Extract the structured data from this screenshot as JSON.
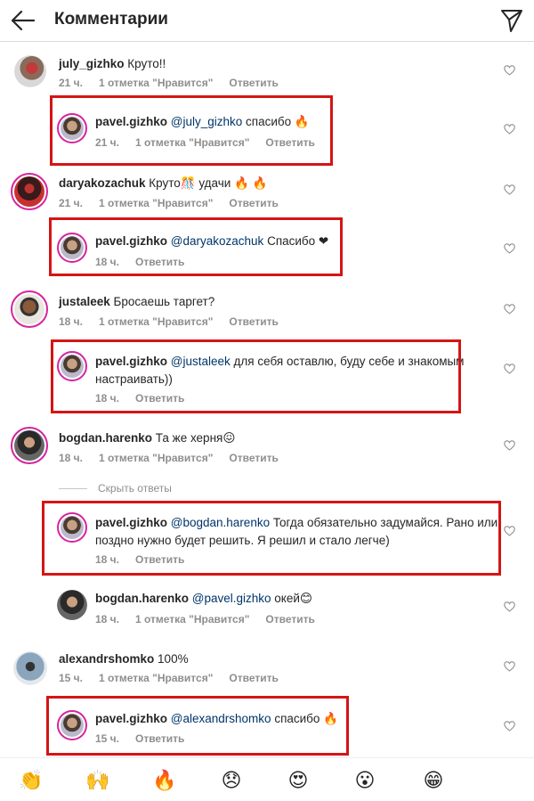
{
  "header": {
    "title": "Комментарии",
    "back_icon": "arrow-left-icon",
    "send_icon": "paper-plane-icon"
  },
  "comments": [
    {
      "user": "july_gizhko",
      "mention": "",
      "text": " Круто!!",
      "text2": "",
      "time": "21 ч.",
      "likes": "1 отметка \"Нравится\"",
      "reply": "Ответить"
    },
    {
      "user": "pavel.gizhko",
      "mention": "@july_gizhko",
      "text": " спасибо 🔥",
      "text2": "",
      "time": "21 ч.",
      "likes": "1 отметка \"Нравится\"",
      "reply": "Ответить"
    },
    {
      "user": "daryakozachuk",
      "mention": "",
      "text": " Круто🎊 удачи 🔥 🔥",
      "text2": "",
      "time": "21 ч.",
      "likes": "1 отметка \"Нравится\"",
      "reply": "Ответить"
    },
    {
      "user": "pavel.gizhko",
      "mention": "@daryakozachuk",
      "text": " Спасибо ❤",
      "text2": "",
      "time": "18 ч.",
      "likes": "",
      "reply": "Ответить"
    },
    {
      "user": "justaleek",
      "mention": "",
      "text": " Бросаешь таргет?",
      "text2": "",
      "time": "18 ч.",
      "likes": "1 отметка \"Нравится\"",
      "reply": "Ответить"
    },
    {
      "user": "pavel.gizhko",
      "mention": "@justaleek",
      "text": " для себя оставлю, буду себе и знакомым",
      "text2": "настраивать))",
      "time": "18 ч.",
      "likes": "",
      "reply": "Ответить"
    },
    {
      "user": "bogdan.harenko",
      "mention": "",
      "text": " Та же херня😖",
      "text2": "",
      "time": "18 ч.",
      "likes": "1 отметка \"Нравится\"",
      "reply": "Ответить"
    },
    {
      "user": "pavel.gizhko",
      "mention": "@bogdan.harenko",
      "text": " Тогда обязательно задумайся. Рано или",
      "text2": "поздно нужно будет решить. Я решил и стало легче)",
      "time": "18 ч.",
      "likes": "",
      "reply": "Ответить"
    },
    {
      "user": "bogdan.harenko",
      "mention": "@pavel.gizhko",
      "text": " окей😊",
      "text2": "",
      "time": "18 ч.",
      "likes": "1 отметка \"Нравится\"",
      "reply": "Ответить"
    },
    {
      "user": "alexandrshomko",
      "mention": "",
      "text": " 100%",
      "text2": "",
      "time": "15 ч.",
      "likes": "1 отметка \"Нравится\"",
      "reply": "Ответить"
    },
    {
      "user": "pavel.gizhko",
      "mention": "@alexandrshomko",
      "text": " спасибо 🔥",
      "text2": "",
      "time": "15 ч.",
      "likes": "",
      "reply": "Ответить"
    }
  ],
  "hide_replies": "Скрыть ответы",
  "emoji_bar": [
    "👏",
    "🙌",
    "🔥",
    "😞",
    "😍",
    "😮",
    "😁"
  ],
  "colors": {
    "highlight": "#d41515",
    "mention": "#003569",
    "story_ring": "#d6249f"
  }
}
